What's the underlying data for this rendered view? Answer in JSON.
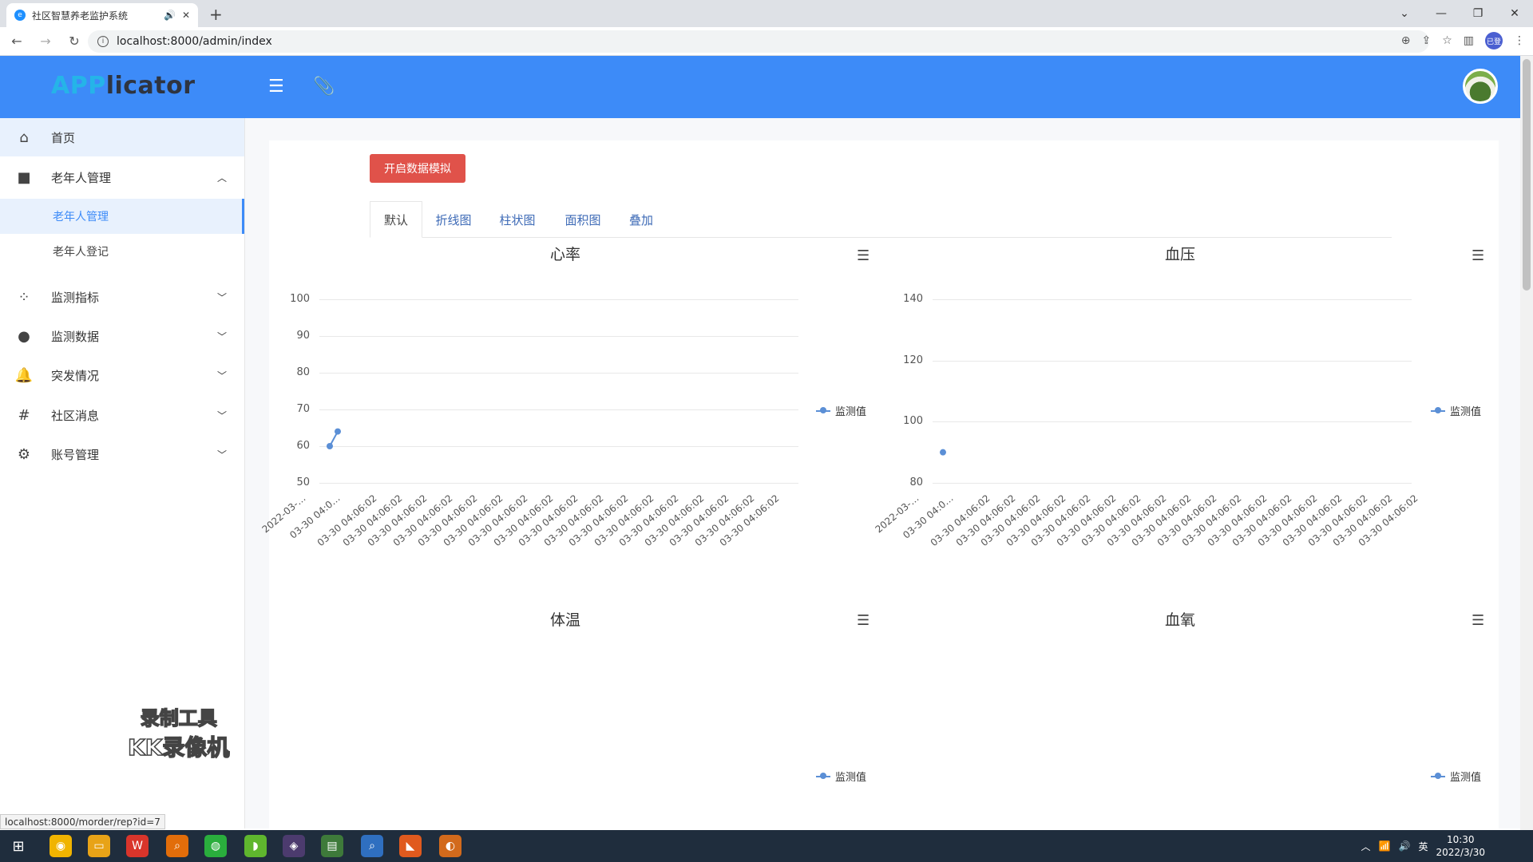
{
  "browser": {
    "tab_title": "社区智慧养老监护系统",
    "url": "localhost:8000/admin/index",
    "status_url": "localhost:8000/morder/rep?id=7",
    "profile_label": "已登"
  },
  "header": {
    "logo_part1": "APP",
    "logo_part2": "licator"
  },
  "sidebar": {
    "items": [
      {
        "label": "首页",
        "icon": "home-icon"
      },
      {
        "label": "老年人管理",
        "icon": "square-icon"
      },
      {
        "label": "监测指标",
        "icon": "spinner-icon"
      },
      {
        "label": "监测数据",
        "icon": "circle-icon"
      },
      {
        "label": "突发情况",
        "icon": "bell-icon"
      },
      {
        "label": "社区消息",
        "icon": "hash-icon"
      },
      {
        "label": "账号管理",
        "icon": "gears-icon"
      }
    ],
    "submenu": [
      {
        "label": "老年人管理",
        "active": true
      },
      {
        "label": "老年人登记",
        "active": false
      }
    ],
    "watermark_line1": "录制工具",
    "watermark_line2": "KK录像机"
  },
  "main": {
    "simulate_button": "开启数据模拟",
    "tabs": [
      "默认",
      "折线图",
      "柱状图",
      "面积图",
      "叠加"
    ],
    "active_tab": "默认"
  },
  "chart_data": [
    {
      "type": "line",
      "title": "心率",
      "legend": [
        "监测值"
      ],
      "yticks": [
        50,
        60,
        70,
        80,
        90,
        100
      ],
      "ylim": [
        50,
        100
      ],
      "x": [
        "2022-03-…",
        "03-30 04:0…",
        "03-30 04:06:02",
        "03-30 04:06:02",
        "03-30 04:06:02",
        "03-30 04:06:02",
        "03-30 04:06:02",
        "03-30 04:06:02",
        "03-30 04:06:02",
        "03-30 04:06:02",
        "03-30 04:06:02",
        "03-30 04:06:02",
        "03-30 04:06:02",
        "03-30 04:06:02",
        "03-30 04:06:02",
        "03-30 04:06:02",
        "03-30 04:06:02",
        "03-30 04:06:02",
        "03-30 04:06:02"
      ],
      "series": [
        {
          "name": "监测值",
          "values": [
            60,
            64
          ]
        }
      ]
    },
    {
      "type": "scatter",
      "title": "血压",
      "legend": [
        "监测值"
      ],
      "yticks": [
        80,
        100,
        120,
        140
      ],
      "ylim": [
        80,
        140
      ],
      "x": [
        "2022-03-…",
        "03-30 04:0…",
        "03-30 04:06:02",
        "03-30 04:06:02",
        "03-30 04:06:02",
        "03-30 04:06:02",
        "03-30 04:06:02",
        "03-30 04:06:02",
        "03-30 04:06:02",
        "03-30 04:06:02",
        "03-30 04:06:02",
        "03-30 04:06:02",
        "03-30 04:06:02",
        "03-30 04:06:02",
        "03-30 04:06:02",
        "03-30 04:06:02",
        "03-30 04:06:02",
        "03-30 04:06:02",
        "03-30 04:06:02",
        "03-30 04:06:02"
      ],
      "series": [
        {
          "name": "监测值",
          "values": [
            90
          ]
        }
      ]
    },
    {
      "type": "line",
      "title": "体温",
      "legend": [
        "监测值"
      ]
    },
    {
      "type": "line",
      "title": "血氧",
      "legend": [
        "监测值"
      ]
    }
  ],
  "taskbar": {
    "time": "10:30",
    "date": "2022/3/30",
    "ime": "英"
  },
  "colors": {
    "header": "#3d8bf8",
    "primary_button": "#e0524a",
    "series": "#5b8fd6"
  }
}
